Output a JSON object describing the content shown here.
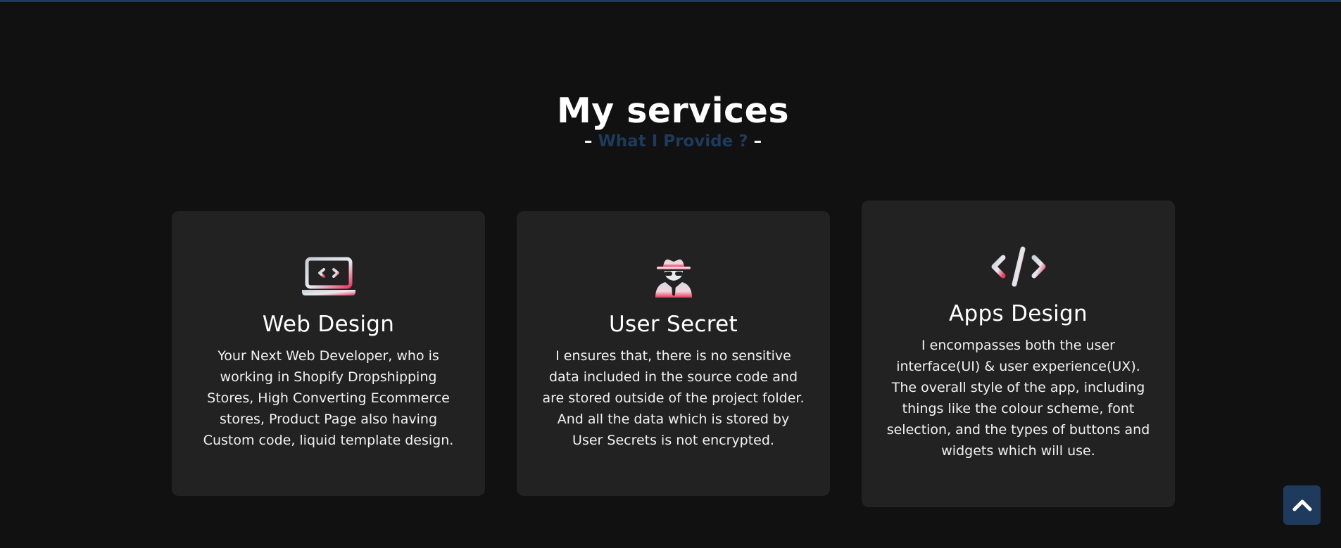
{
  "section": {
    "title": "My services",
    "subtitle_dash_left": "–",
    "subtitle": "What I Provide ?",
    "subtitle_dash_right": "–"
  },
  "services": [
    {
      "icon": "laptop-code-icon",
      "title": "Web Design",
      "text": "Your Next Web Developer, who is working in Shopify Dropshipping Stores, High Converting Ecommerce stores, Product Page also having Custom code, liquid template design."
    },
    {
      "icon": "user-secret-icon",
      "title": "User Secret",
      "text": "I ensures that, there is no sensitive data included in the source code and are stored outside of the project folder. And all the data which is stored by User Secrets is not encrypted."
    },
    {
      "icon": "code-icon",
      "title": "Apps Design",
      "text": "I encompasses both the user interface(UI) & user experience(UX). The overall style of the app, including things like the colour scheme, font selection, and the types of buttons and widgets which will use."
    }
  ],
  "scroll_top": {
    "icon": "chevron-up-icon"
  },
  "colors": {
    "background": "#111111",
    "card": "#222222",
    "accent": "#1e3a5c",
    "icon_gradient_start": "#c9ced6",
    "icon_gradient_end": "#e8395f"
  }
}
